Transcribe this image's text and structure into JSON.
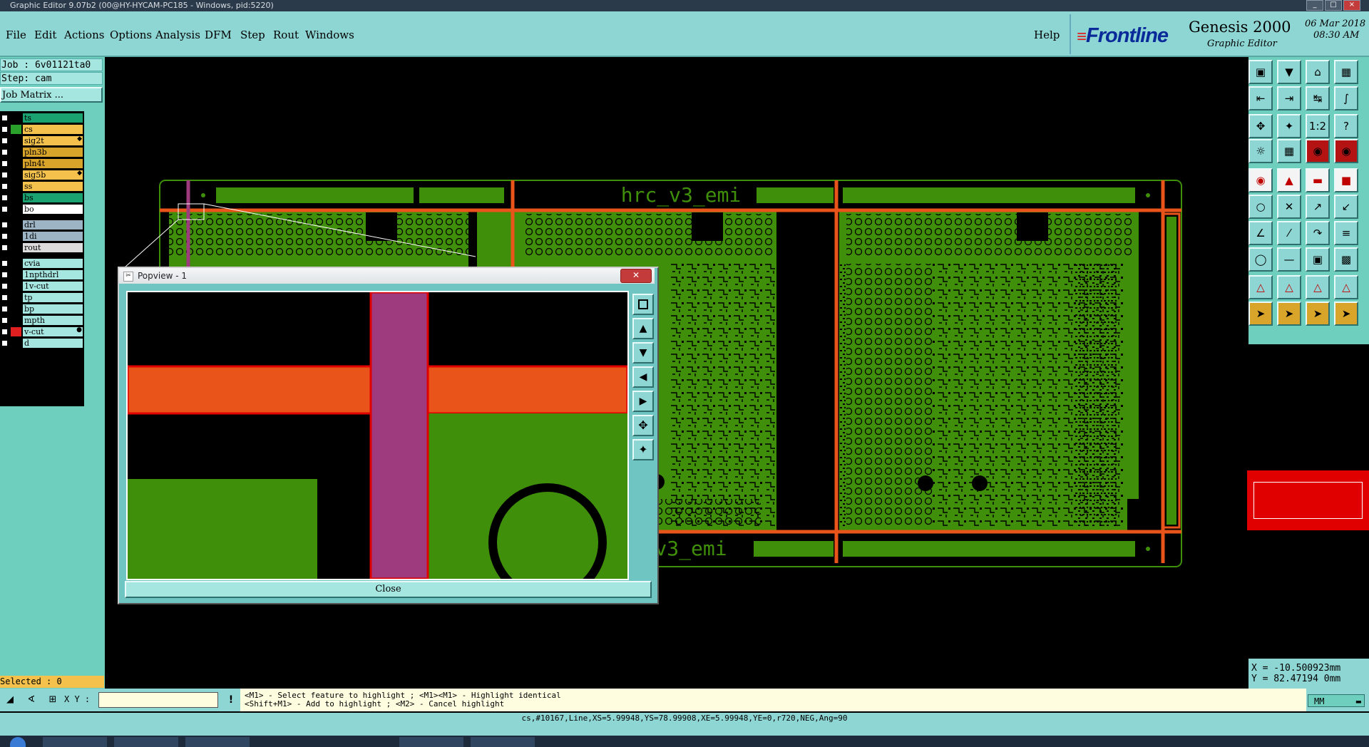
{
  "window": {
    "title": "Graphic Editor 9.07b2 (00@HY-HYCAM-PC185 - Windows, pid:5220)"
  },
  "menu": {
    "items": [
      "File",
      "Edit",
      "Actions",
      "Options",
      "Analysis",
      "DFM",
      "Step",
      "Rout",
      "Windows"
    ],
    "help": "Help"
  },
  "brand": {
    "logo": "Frontline",
    "product": "Genesis 2000",
    "subtitle": "Graphic Editor",
    "date": "06 Mar 2018",
    "time": "08:30 AM"
  },
  "info": {
    "job": "Job : 6v01121ta0",
    "step": "Step: cam",
    "matrix_button": "Job Matrix ..."
  },
  "layers": [
    {
      "name": "ts",
      "color": "#1aa370",
      "swatch": "#000000",
      "marker": ""
    },
    {
      "name": "cs",
      "color": "#f3c14c",
      "swatch": "#2aa12a",
      "marker": ""
    },
    {
      "name": "sig2t",
      "color": "#f3c14c",
      "swatch": "#000000",
      "marker": "&#9670;"
    },
    {
      "name": "pln3b",
      "color": "#d9a42a",
      "swatch": "#000000",
      "marker": ""
    },
    {
      "name": "pln4t",
      "color": "#d9a42a",
      "swatch": "#000000",
      "marker": ""
    },
    {
      "name": "sig5b",
      "color": "#f3c14c",
      "swatch": "#000000",
      "marker": "&#9670;"
    },
    {
      "name": "ss",
      "color": "#f3c14c",
      "swatch": "#000000",
      "marker": ""
    },
    {
      "name": "bs",
      "color": "#1aa370",
      "swatch": "#000000",
      "marker": ""
    },
    {
      "name": "bo",
      "color": "#ffffff",
      "swatch": "#000000",
      "marker": ""
    },
    {
      "name": "drl",
      "color": "#9cb4c4",
      "swatch": "#000000",
      "marker": ""
    },
    {
      "name": "1di",
      "color": "#9cb4c4",
      "swatch": "#000000",
      "marker": ""
    },
    {
      "name": "rout",
      "color": "#dcdcdc",
      "swatch": "#000000",
      "marker": ""
    },
    {
      "name": "cvia",
      "color": "#a6e6e0",
      "swatch": "#000000",
      "marker": ""
    },
    {
      "name": "1npthdrl",
      "color": "#a6e6e0",
      "swatch": "#000000",
      "marker": ""
    },
    {
      "name": "1v-cut",
      "color": "#a6e6e0",
      "swatch": "#000000",
      "marker": ""
    },
    {
      "name": "tp",
      "color": "#a6e6e0",
      "swatch": "#000000",
      "marker": ""
    },
    {
      "name": "bp",
      "color": "#a6e6e0",
      "swatch": "#000000",
      "marker": ""
    },
    {
      "name": "mpth",
      "color": "#a6e6e0",
      "swatch": "#000000",
      "marker": ""
    },
    {
      "name": "v-cut",
      "color": "#a6e6e0",
      "swatch": "#e02020",
      "marker": "&#9679;"
    },
    {
      "name": "d",
      "color": "#a6e6e0",
      "swatch": "#000000",
      "marker": ""
    }
  ],
  "selected": "Selected : 0",
  "board": {
    "label_top": "hrc_v3_emi",
    "label_bottom": "v3_emi"
  },
  "popview": {
    "title": "Popview - 1",
    "close_label": "Close"
  },
  "coords": {
    "x": "X = -10.500923mm",
    "y": "Y =  82.47194 0mm"
  },
  "input": {
    "xy_label": "X Y :",
    "value": ""
  },
  "prompt": {
    "line1": "<M1> - Select feature to highlight ; <M1><M1> - Highlight identical",
    "line2": "<Shift+M1> - Add to highlight ; <M2> - Cancel highlight"
  },
  "units": "MM",
  "status": "cs,#10167,Line,XS=5.99948,YS=78.99908,XE=5.99948,YE=0,r720,NEG,Ang=90",
  "colors": {
    "panel": "#8ed6d4",
    "board": "#3f8f0a",
    "trace": "#e8541a",
    "popview_highlight": "#9e3a7e",
    "accent_red": "#e00000"
  }
}
